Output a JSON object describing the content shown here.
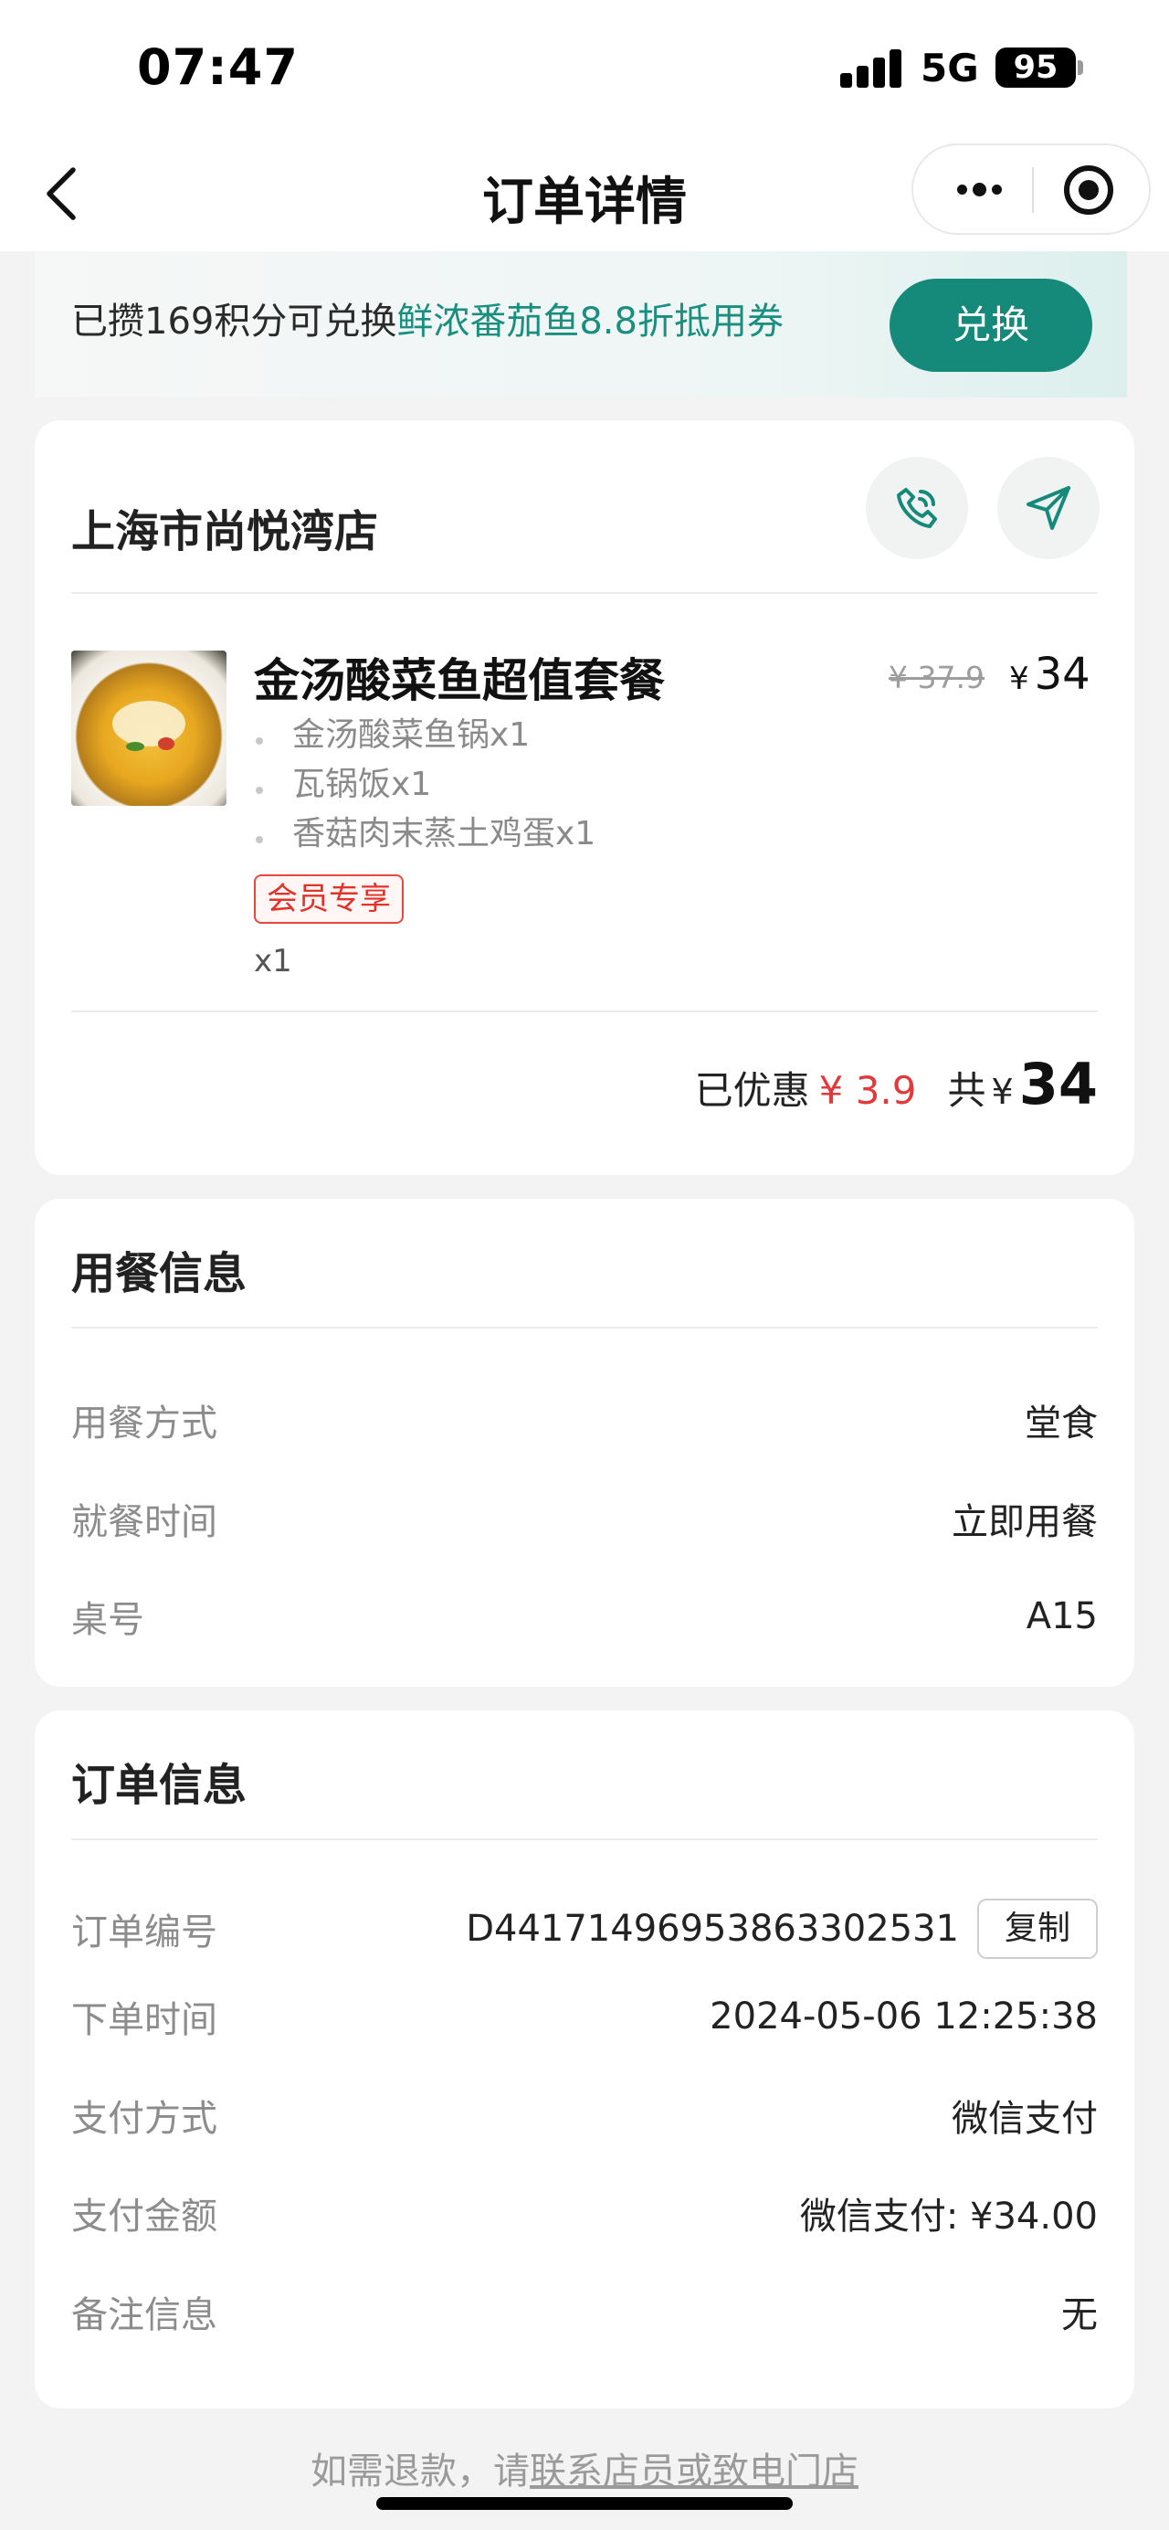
{
  "status_bar": {
    "time": "07:47",
    "network": "5G",
    "battery": "95"
  },
  "nav": {
    "title": "订单详情"
  },
  "promo": {
    "text_prefix": "已攒169积分可兑换",
    "text_highlight": "鲜浓番茄鱼8.8折抵用券",
    "button_label": "兑换",
    "highlight_color": "#1a8f80",
    "button_color": "#168a7a"
  },
  "store": {
    "name": "上海市尚悦湾店",
    "item": {
      "name": "金汤酸菜鱼超值套餐",
      "original_price": "¥ 37.9",
      "currency": "¥",
      "price": "34",
      "components": [
        "金汤酸菜鱼锅x1",
        "瓦锅饭x1",
        "香菇肉末蒸土鸡蛋x1"
      ],
      "tag": "会员专享",
      "quantity": "x1"
    },
    "summary": {
      "discount_label": "已优惠",
      "discount_value": "¥ 3.9",
      "total_label": "共",
      "currency": "¥",
      "total": "34"
    }
  },
  "dining_info": {
    "title": "用餐信息",
    "rows": [
      {
        "label": "用餐方式",
        "value": "堂食"
      },
      {
        "label": "就餐时间",
        "value": "立即用餐"
      },
      {
        "label": "桌号",
        "value": "A15"
      }
    ]
  },
  "order_info": {
    "title": "订单信息",
    "copy_label": "复制",
    "rows": [
      {
        "label": "订单编号",
        "value": "D44171496953863302531"
      },
      {
        "label": "下单时间",
        "value": "2024-05-06 12:25:38"
      },
      {
        "label": "支付方式",
        "value": "微信支付"
      },
      {
        "label": "支付金额",
        "value": "微信支付: ¥34.00"
      },
      {
        "label": "备注信息",
        "value": "无"
      }
    ]
  },
  "footer": {
    "prefix": "如需退款，请",
    "link": "联系店员或致电门店"
  },
  "colors": {
    "accent": "#168a7a",
    "discount": "#e23a3a",
    "tag": "#e2332a"
  },
  "icons": [
    "back-icon",
    "more-icon",
    "target-icon",
    "phone-icon",
    "navigate-icon"
  ]
}
